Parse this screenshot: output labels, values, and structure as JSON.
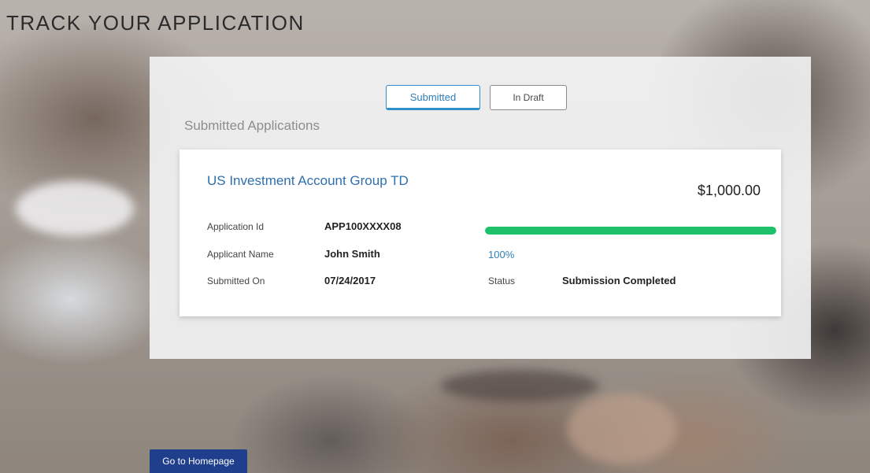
{
  "page": {
    "title": "TRACK YOUR APPLICATION"
  },
  "tabs": [
    {
      "label": "Submitted",
      "active": true
    },
    {
      "label": "In Draft",
      "active": false
    }
  ],
  "section": {
    "heading": "Submitted Applications"
  },
  "application": {
    "name": "US Investment Account Group TD",
    "amount": "$1,000.00",
    "fields": {
      "application_id": {
        "label": "Application Id",
        "value": "APP100XXXX08"
      },
      "applicant_name": {
        "label": "Applicant Name",
        "value": "John Smith"
      },
      "submitted_on": {
        "label": "Submitted On",
        "value": "07/24/2017"
      }
    },
    "progress": {
      "percent": 100,
      "percent_label": "100%"
    },
    "status": {
      "label": "Status",
      "value": "Submission Completed"
    }
  },
  "footer": {
    "home_button_label": "Go to Homepage"
  },
  "colors": {
    "accent": "#2f8fca",
    "link": "#2f6fad",
    "progress": "#1fc06a",
    "button": "#1f3e8c"
  }
}
